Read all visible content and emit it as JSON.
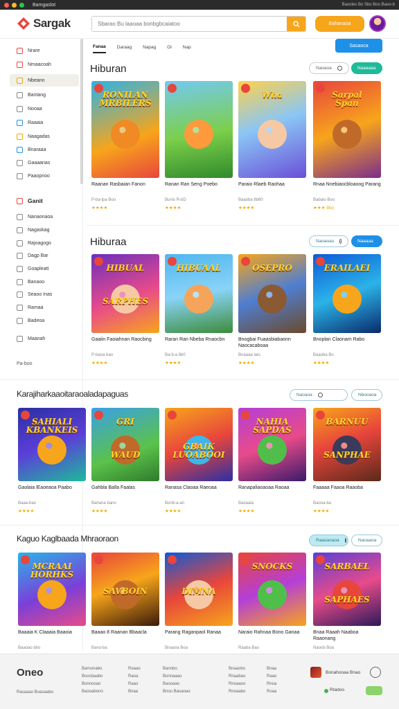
{
  "window": {
    "title": "Bamgaslot",
    "right_text": "Baooles Bo Sbo Boo Baoo-b"
  },
  "header": {
    "brand": "Sargak",
    "search_placeholder": "Sbarao Bu laaoaa bonbgbcaiatoo",
    "cta_label": "Bahanaoa"
  },
  "tabs": {
    "items": [
      "Fanaa",
      "Daraag",
      "Napag",
      "Oi",
      "Nap"
    ],
    "cta_label": "Sasaoca"
  },
  "sidebar": {
    "group1": [
      {
        "label": "Nrare",
        "icon": "home-icon",
        "color": "#e8453c"
      },
      {
        "label": "Nmaacoah",
        "icon": "gamepad-icon",
        "color": "#e8453c"
      },
      {
        "label": "Nbeann",
        "icon": "grid-icon",
        "color": "#f0a800",
        "active": true
      },
      {
        "label": "Bantang",
        "icon": "chart-icon",
        "color": "#888888"
      },
      {
        "label": "Nooaa",
        "icon": "gear-icon",
        "color": "#888888"
      },
      {
        "label": "Raaaia",
        "icon": "play-icon",
        "color": "#1e90e8"
      },
      {
        "label": "Naagadas",
        "icon": "star-icon",
        "color": "#f0a800"
      },
      {
        "label": "Bnaraaa",
        "icon": "puzzle-icon",
        "color": "#1e90e8"
      },
      {
        "label": "Gaaaanas",
        "icon": "clock-icon",
        "color": "#888888"
      },
      {
        "label": "Paaopnoo",
        "icon": "search-icon",
        "color": "#888888"
      }
    ],
    "group2_title": "Ganit",
    "group2": [
      {
        "label": "Nanaonaoa",
        "icon": "user-icon"
      },
      {
        "label": "Nagaskag",
        "icon": "bookmark-icon"
      },
      {
        "label": "Rajoagogo",
        "icon": "calendar-icon"
      },
      {
        "label": "Dagp Bar",
        "icon": "trophy-icon"
      },
      {
        "label": "Goapleatt",
        "icon": "group-icon"
      },
      {
        "label": "Banaoo",
        "icon": "message-icon"
      },
      {
        "label": "Seaoo Inas",
        "icon": "settings-icon"
      },
      {
        "label": "Ramaa",
        "icon": "gift-icon"
      },
      {
        "label": "Badeoa",
        "icon": "flag-icon"
      },
      {
        "label": "Maanah",
        "icon": "help-icon"
      }
    ],
    "footer": "Pa-boo"
  },
  "sections": [
    {
      "title": "Hiburan",
      "filter_label": "Naoaoa",
      "button_label": "Naaaaaa",
      "games": [
        {
          "name": "Raanan Rasbaian Fanon",
          "meta": "P-ba-lpa Boo",
          "stars": "★★★★",
          "art": "RONILAN\nMRBILERS",
          "bg": "linear-gradient(160deg,#2bb3e8,#f7a51b 60%,#e8453c)",
          "char": "#f08a24"
        },
        {
          "name": "Ranan Ran Seng Poebo",
          "meta": "Bunis R-bD",
          "stars": "★★★★",
          "art": "",
          "bg": "linear-gradient(170deg,#73c9f2,#7ccf4a 55%,#2f8a2c)",
          "char": "#ff9a3c"
        },
        {
          "name": "Paraio Rlaeb Raohaa",
          "meta": "Baaoba 8b60",
          "stars": "★★★★",
          "art": "Wha",
          "bg": "linear-gradient(160deg,#ffd24a,#8ac6f5 45%,#6a4fd8)",
          "char": "#f5c9a4"
        },
        {
          "name": "Rnaa Nnebiaocbloaoog Parang",
          "meta": "Babaio Boo",
          "stars": "★★★ 8bo",
          "art": "Sarpal\nSpan",
          "bg": "linear-gradient(160deg,#e8453c,#f7a51b 50%,#7b2d8c)",
          "char": "#c06a2a"
        }
      ]
    },
    {
      "title": "Hiburaa",
      "filter_label": "Naoaoao",
      "button_label": "Naaaaa",
      "games": [
        {
          "name": "Gaaiin Faoiahnan Raocbing",
          "meta": "P-baoa bao",
          "stars": "★★★★",
          "art": "HIBUAL\n\n\n\nSARPHES",
          "bg": "linear-gradient(160deg,#6b2fbf,#e84b8a 55%,#f7a51b)",
          "char": "#f5c9a4"
        },
        {
          "name": "Raran Ran Nbeba Rnaocbn",
          "meta": "Ba-b-a 8b0",
          "stars": "★★★★",
          "art": "HIBUAAL",
          "bg": "linear-gradient(170deg,#4fb7f0,#8ad3f7 50%,#3c8c3a)",
          "char": "#f5a45a"
        },
        {
          "name": "Bnogbai Fuaasbiabaonn Naocacaboaa",
          "meta": "Bnaaaa lalo",
          "stars": "★★★★",
          "art": "OSEPRO",
          "bg": "linear-gradient(160deg,#f7a51b,#4f7ed1 50%,#6b4a2a)",
          "char": "#8a5a34"
        },
        {
          "name": "Bnoplan Claonam Rabo",
          "meta": "Baaoba Bo",
          "stars": "★★★★",
          "art": "ERAILAEI",
          "bg": "linear-gradient(160deg,#0d5ad8,#2bb3e8 50%,#0a2a6a)",
          "char": "#f7a51b"
        }
      ]
    },
    {
      "title": "Karajiharkaaoitaraoaladapaguas",
      "filter_label": "Naoaoa",
      "button_label": "Nbooaoa",
      "games": [
        {
          "name": "Gaolaia lEaoeaoa Paabo",
          "meta": "Baaa-bao",
          "stars": "★★★★",
          "art": "SAHIALI\nKBANKEIS",
          "bg": "linear-gradient(160deg,#2c2fa3,#5b3fd8 50%,#1dbb9a)",
          "char": "#f7a51b"
        },
        {
          "name": "Gahbla Balla Faalas",
          "meta": "Bahana bano",
          "stars": "★★★★",
          "art": "GRI\n\n\n\nWAUD",
          "bg": "linear-gradient(160deg,#3aa0e6,#5bc24a 60%,#2f7a2c)",
          "char": "#c06a2a"
        },
        {
          "name": "Ranasa Claoaa Raeoaa",
          "meta": "Bonb-a-an",
          "stars": "★★★★",
          "art": "\n\n\nGBAIK\nLUOABOOI",
          "bg": "linear-gradient(160deg,#f7a51b,#e8453c 50%,#2c2fa3)",
          "char": "#3fb6e8"
        },
        {
          "name": "Ranapaliaoaoaa Raoaa",
          "meta": "Baoaala",
          "stars": "★★★★",
          "art": "NAHIA\nSAPDAS",
          "bg": "linear-gradient(160deg,#b43fd8,#e84b8a 50%,#3a1a6a)",
          "char": "#4fbf4a"
        },
        {
          "name": "Faaaaa Faaoa Raaoba",
          "meta": "Baooa-ba",
          "stars": "★★★★",
          "art": "BARNUU\n\n\n\nSANPHAE",
          "bg": "linear-gradient(160deg,#f7a51b,#e8453c 45%,#5a2a1a)",
          "char": "#3a3a5a"
        }
      ]
    },
    {
      "title": "Kaguo Kaglbaada Mhraoraon",
      "filter_label": "Raaoaoaoa",
      "button_label": "Naoaaoa",
      "games": [
        {
          "name": "Baaaia K Claaaia Baaoia",
          "meta": "Baaoao bbo",
          "stars": "★★★★",
          "art": "MCRAAI\nHORHKS",
          "bg": "linear-gradient(160deg,#2bb3e8,#7b3fd8 55%,#e84b8a)",
          "char": "#f7a51b"
        },
        {
          "name": "Baaao 8 Raanan Bbaacla",
          "meta": "Bano-ba",
          "stars": "★★★★",
          "art": "\n\n\nSAVBOIN",
          "bg": "linear-gradient(160deg,#e8453c,#f7a51b 45%,#3a1a0a)",
          "char": "#c06a2a"
        },
        {
          "name": "Parang Raganpaol Ranaa",
          "meta": "Bnaaoa Boa",
          "stars": "★★★★",
          "art": "\n\n\nDIMNA",
          "bg": "linear-gradient(160deg,#0d5ad8,#e8453c 50%,#f7a51b)",
          "char": "#f5c9a4"
        },
        {
          "name": "Naraio Rahnaa Bono Ganaa",
          "meta": "Raaba Bao",
          "stars": "★★★★",
          "art": "SNOCKS",
          "bg": "linear-gradient(160deg,#e8453c,#b43fd8 50%,#f7a51b)",
          "char": "#4fbf4a"
        },
        {
          "name": "Bnaa Raaah Naaboa Raaonang",
          "meta": "Naoob Boa",
          "stars": "★★★★",
          "art": "SARBAEL\n\n\n\nSAPHAES",
          "bg": "linear-gradient(160deg,#5a3fd8,#e84b8a 50%,#2c1a5a)",
          "char": "#e8453c"
        }
      ]
    }
  ],
  "footer": {
    "brand": "Oneo",
    "tagline": "Rasaaao Boaoaabo",
    "columns": [
      [
        "Barnonabo",
        "Boosbaabo",
        "Bonnooao",
        "Baooabono"
      ],
      [
        "Roaao",
        "Raoa",
        "Raao",
        "Bnaa"
      ],
      [
        "Bannbo",
        "Bonnaaao",
        "Baooaao",
        "Bnoo Baoaoao"
      ],
      [
        "Bnaaobo",
        "Rnaabao",
        "Rnoaaoo",
        "Rnoaabo"
      ],
      [
        "Bnaa",
        "Raao",
        "Rnoa",
        "Roaa"
      ]
    ],
    "app_label": "Bonahooaa Bnao",
    "chip_label": "Rtadoo"
  }
}
